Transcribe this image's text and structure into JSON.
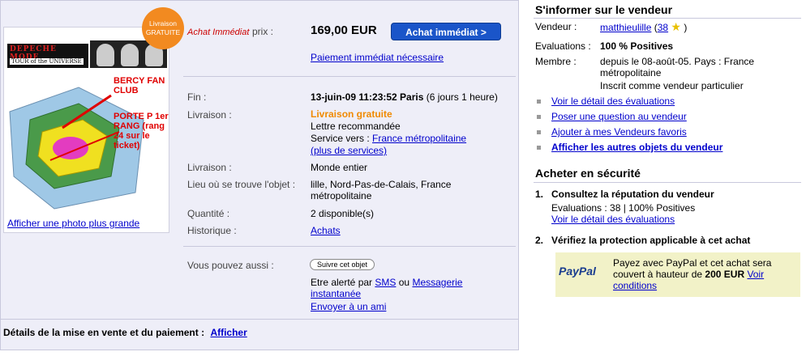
{
  "left": {
    "badge_top": "Livraison",
    "badge_bottom": "GRATUITE",
    "photo": {
      "logo_line1": "DEPECHE MODE",
      "logo_line2": "TOUR of the UNIVERSE",
      "overlay1": "BERCY FAN CLUB",
      "overlay2": "PORTE P 1er RANG (rang 24 sur le ticket)",
      "link": "Afficher une photo plus grande"
    },
    "buy": {
      "type_label": "Achat Immédiat",
      "price_label": "prix :",
      "price": "169,00 EUR",
      "button": "Achat immédiat >",
      "payment_link": "Paiement immédiat nécessaire"
    },
    "details": {
      "fin_label": "Fin :",
      "fin_value": "13-juin-09 11:23:52 Paris",
      "fin_rest": "(6 jours 1 heure)",
      "livraison_label": "Livraison :",
      "livraison_free": "Livraison gratuite",
      "livraison_method": "Lettre recommandée",
      "service_prefix": "Service vers :",
      "service_link": "France métropolitaine",
      "more_services": "(plus de services)",
      "livraison2_label": "Livraison :",
      "livraison2_value": "Monde entier",
      "location_label": "Lieu où se trouve l'objet :",
      "location_value": "lille, Nord-Pas-de-Calais, France métropolitaine",
      "qty_label": "Quantité :",
      "qty_value": "2 disponible(s)",
      "history_label": "Historique :",
      "history_link": "Achats"
    },
    "also": {
      "label": "Vous pouvez aussi :",
      "follow_button": "Suivre cet objet",
      "alert_prefix": "Etre alerté par",
      "sms_link": "SMS",
      "or": "ou",
      "messaging_link": "Messagerie instantanée",
      "send_friend": "Envoyer à un ami"
    },
    "footer_label": "Détails de la mise en vente et du paiement :",
    "footer_link": "Afficher"
  },
  "seller": {
    "title": "S'informer sur le vendeur",
    "vendor_label": "Vendeur :",
    "vendor_name": "matthieulille",
    "paren_open": "(",
    "vendor_score": "38",
    "paren_close": ")",
    "evals_label": "Evaluations :",
    "evals_value": "100 % Positives",
    "member_label": "Membre :",
    "member_value": "depuis le 08-août-05. Pays : France métropolitaine",
    "member_type": "Inscrit comme vendeur particulier",
    "links": [
      "Voir le détail des évaluations",
      "Poser une question au vendeur",
      "Ajouter à mes Vendeurs favoris",
      "Afficher les autres objets du vendeur"
    ]
  },
  "secure": {
    "title": "Acheter en sécurité",
    "step1_num": "1.",
    "step1_title": "Consultez la réputation du vendeur",
    "step1_evals": "Evaluations : 38 | 100% Positives",
    "step1_link": "Voir le détail des évaluations",
    "step2_num": "2.",
    "step2_title": "Vérifiez la protection applicable à cet achat",
    "paypal_logo": "PayPal",
    "paypal_text1": "Payez avec PayPal et cet achat sera couvert à hauteur de",
    "paypal_amount": "200 EUR",
    "paypal_link": "Voir conditions"
  }
}
